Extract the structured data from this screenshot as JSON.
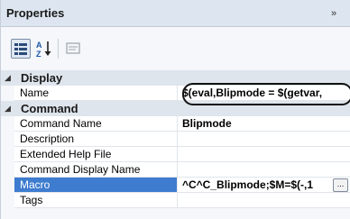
{
  "panel": {
    "title": "Properties",
    "collapse_glyph": "»"
  },
  "toolbar": {
    "categorized_icon": "categorized-view-icon",
    "alphabetical_icon": "alphabetical-sort-icon",
    "property_pages_icon": "property-pages-icon"
  },
  "grid": {
    "display": {
      "label": "Display",
      "rows": [
        {
          "name": "Name",
          "value": "$(eval,Blipmode = $(getvar,"
        }
      ]
    },
    "command": {
      "label": "Command",
      "rows": [
        {
          "name": "Command Name",
          "value": "Blipmode"
        },
        {
          "name": "Description",
          "value": ""
        },
        {
          "name": "Extended Help File",
          "value": ""
        },
        {
          "name": "Command Display Name",
          "value": ""
        },
        {
          "name": "Macro",
          "value": "^C^C_Blipmode;$M=$(-,1",
          "button": "..."
        },
        {
          "name": "Tags",
          "value": ""
        }
      ]
    }
  },
  "colors": {
    "selected": "#3e7ccf",
    "category_bg": "#dfe5ec"
  }
}
